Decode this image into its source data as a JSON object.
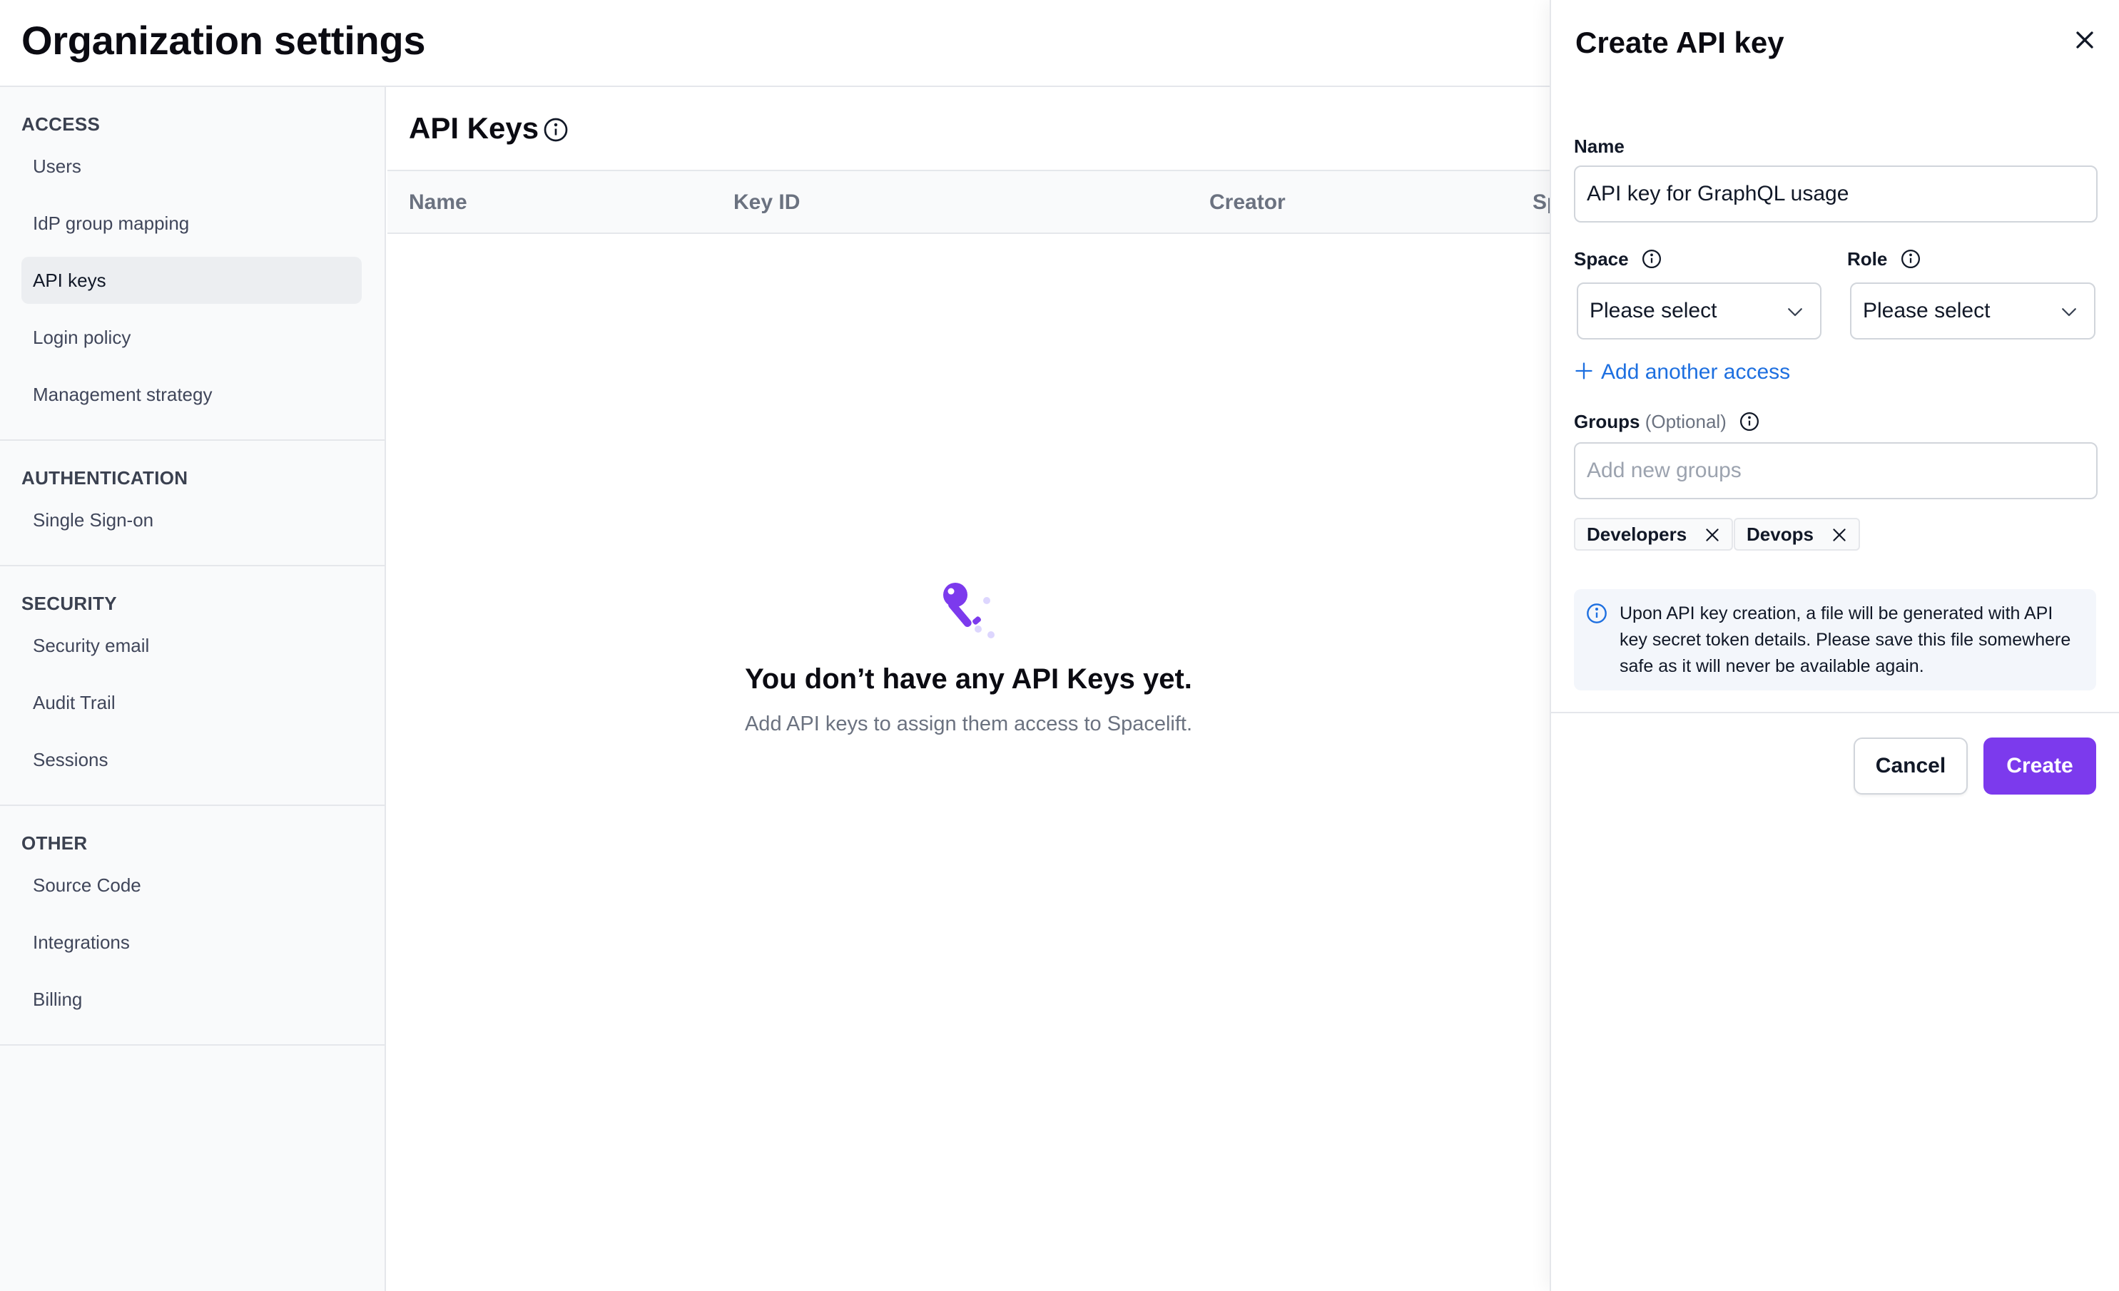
{
  "page": {
    "title": "Organization settings"
  },
  "sidebar": {
    "sections": [
      {
        "title": "ACCESS",
        "items": [
          "Users",
          "IdP group mapping",
          "API keys",
          "Login policy",
          "Management strategy"
        ]
      },
      {
        "title": "AUTHENTICATION",
        "items": [
          "Single Sign-on"
        ]
      },
      {
        "title": "SECURITY",
        "items": [
          "Security email",
          "Audit Trail",
          "Sessions"
        ]
      },
      {
        "title": "OTHER",
        "items": [
          "Source Code",
          "Integrations",
          "Billing"
        ]
      }
    ],
    "active_item": "API keys"
  },
  "main": {
    "title": "API Keys",
    "title_icon": "info-icon",
    "columns": [
      "Name",
      "Key ID",
      "Creator",
      "Sp"
    ],
    "empty": {
      "icon": "key-icon",
      "title": "You don’t have any API Keys yet.",
      "subtitle": "Add API keys to assign them access to Spacelift."
    }
  },
  "drawer": {
    "title": "Create API key",
    "close_icon": "close-icon",
    "name_label": "Name",
    "name_value": "API key for GraphQL usage",
    "space_label": "Space",
    "space_value": "Please select",
    "role_label": "Role",
    "role_value": "Please select",
    "add_access": "Add another access",
    "groups_label": "Groups",
    "groups_optional": "(Optional)",
    "groups_placeholder": "Add new groups",
    "groups": [
      "Developers",
      "Devops"
    ],
    "notice": "Upon API key creation, a file will be generated with API key secret token details. Please save this file somewhere safe as it will never be available again.",
    "cancel_label": "Cancel",
    "create_label": "Create"
  },
  "colors": {
    "accent": "#7c3aed",
    "link": "#1d6fe0",
    "active_item_bg": "#eceef1",
    "notice_bg": "#f3f6fb"
  }
}
